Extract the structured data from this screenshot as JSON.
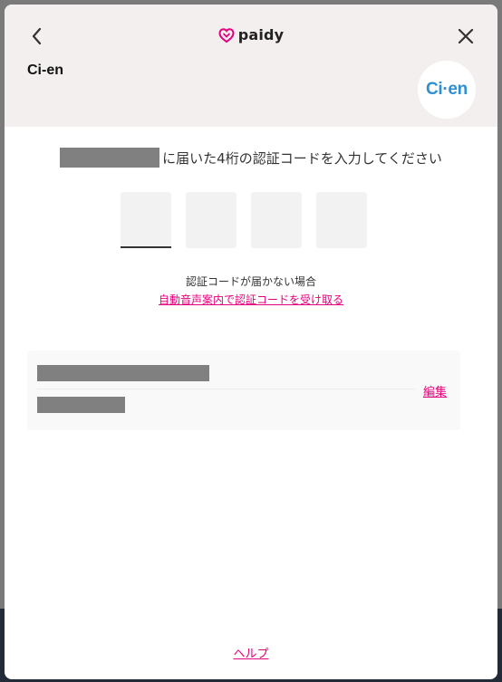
{
  "header": {
    "brand_name": "paidy",
    "merchant_name": "Ci-en",
    "merchant_logo_text": "Ci·en"
  },
  "verification": {
    "prompt_text": "に届いた4桁の認証コードを入力してください",
    "code_digits": [
      "",
      "",
      "",
      ""
    ],
    "no_code_text": "認証コードが届かない場合",
    "voice_link_text": "自動音声案内で認証コードを受け取る"
  },
  "account_card": {
    "edit_label": "編集"
  },
  "footer": {
    "help_label": "ヘルプ"
  },
  "colors": {
    "accent": "#e5007d",
    "header_bg": "#f3efee",
    "merchant_logo": "#2f8fd0"
  }
}
